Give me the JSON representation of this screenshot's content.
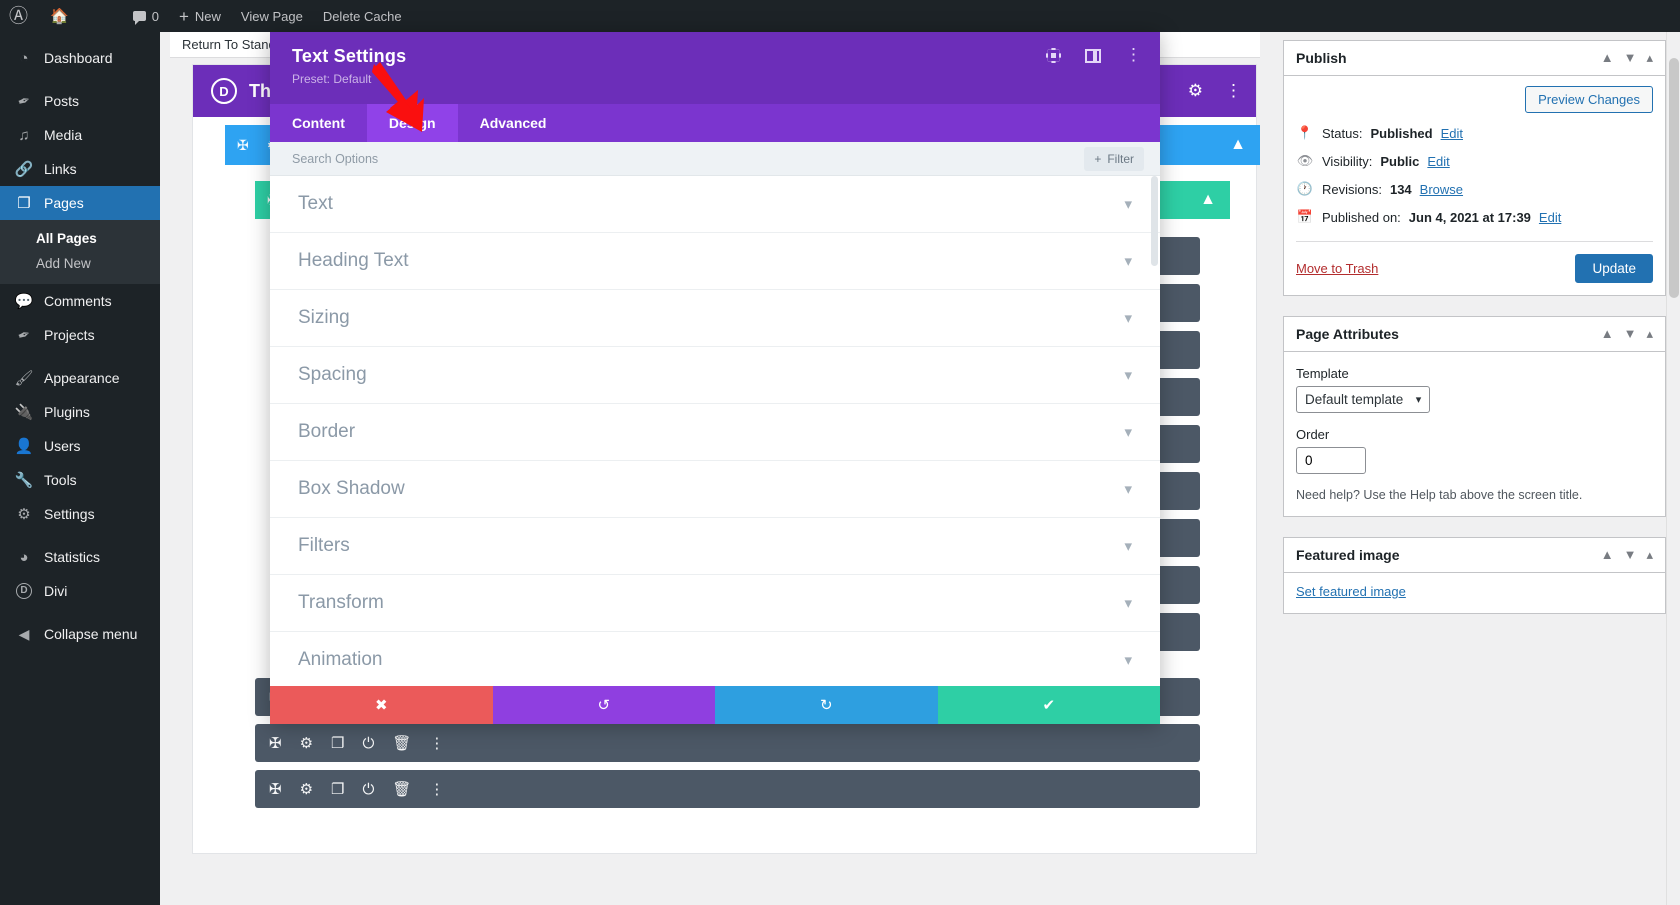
{
  "adminbar": {
    "logo_icon": "wordpress-logo-icon",
    "home_icon": "home-icon",
    "comments_count": "0",
    "new_label": "New",
    "view_page_label": "View Page",
    "delete_cache_label": "Delete Cache"
  },
  "sidebar": {
    "items": [
      {
        "label": "Dashboard",
        "icon": "dashboard-icon",
        "current": false
      },
      {
        "label": "Posts",
        "icon": "posts-pin-icon",
        "current": false
      },
      {
        "label": "Media",
        "icon": "media-icon",
        "current": false
      },
      {
        "label": "Links",
        "icon": "links-chain-icon",
        "current": false
      },
      {
        "label": "Pages",
        "icon": "pages-icon",
        "current": true
      },
      {
        "label": "Comments",
        "icon": "comments-icon",
        "current": false
      },
      {
        "label": "Projects",
        "icon": "projects-pin-icon",
        "current": false
      },
      {
        "label": "Appearance",
        "icon": "appearance-brush-icon",
        "current": false
      },
      {
        "label": "Plugins",
        "icon": "plugins-plug-icon",
        "current": false
      },
      {
        "label": "Users",
        "icon": "users-icon",
        "current": false
      },
      {
        "label": "Tools",
        "icon": "tools-wrench-icon",
        "current": false
      },
      {
        "label": "Settings",
        "icon": "settings-sliders-icon",
        "current": false
      },
      {
        "label": "Statistics",
        "icon": "statistics-pie-icon",
        "current": false
      },
      {
        "label": "Divi",
        "icon": "divi-logo-icon",
        "current": false
      }
    ],
    "submenu": [
      {
        "label": "All Pages",
        "active": true
      },
      {
        "label": "Add New",
        "active": false
      }
    ],
    "collapse_label": "Collapse menu",
    "active_color": "#2271b1"
  },
  "canvas": {
    "return_label": "Return To Standard Editor",
    "divi_title": "The Divi Builder",
    "divi_logo_letter": "D",
    "divi_bar_color": "#6c2eb9",
    "section_color": "#2ea3f2",
    "row_color": "#2ecfa5",
    "module_color": "#4c5866",
    "module_icons": [
      "move-icon",
      "gear-icon",
      "duplicate-icon",
      "power-icon",
      "trash-icon",
      "kebab-icon"
    ]
  },
  "modal": {
    "title": "Text Settings",
    "preset": "Preset: Default",
    "header_icons": [
      "expand-icon",
      "panel-layout-icon",
      "kebab-icon"
    ],
    "header_color": "#6c2eb9",
    "tabs": [
      {
        "label": "Content",
        "active": false
      },
      {
        "label": "Design",
        "active": true
      },
      {
        "label": "Advanced",
        "active": false
      }
    ],
    "search_placeholder": "Search Options",
    "filter_label": "Filter",
    "filter_icon": "plus-icon",
    "sections": [
      {
        "label": "Text"
      },
      {
        "label": "Heading Text"
      },
      {
        "label": "Sizing"
      },
      {
        "label": "Spacing"
      },
      {
        "label": "Border"
      },
      {
        "label": "Box Shadow"
      },
      {
        "label": "Filters"
      },
      {
        "label": "Transform"
      },
      {
        "label": "Animation"
      }
    ],
    "footer": [
      {
        "name": "cancel",
        "icon": "close-x-icon",
        "glyph": "✖",
        "color": "#eb5a5a"
      },
      {
        "name": "undo",
        "icon": "undo-icon",
        "glyph": "↺",
        "color": "#8f3fe0"
      },
      {
        "name": "redo",
        "icon": "redo-icon",
        "glyph": "↻",
        "color": "#2e9fe0"
      },
      {
        "name": "save",
        "icon": "check-icon",
        "glyph": "✔",
        "color": "#2ecfa5"
      }
    ]
  },
  "publish": {
    "title": "Publish",
    "preview_label": "Preview Changes",
    "rows": [
      {
        "icon": "pin-icon",
        "label": "Status:",
        "value": "Published",
        "link": "Edit"
      },
      {
        "icon": "eye-icon",
        "label": "Visibility:",
        "value": "Public",
        "link": "Edit"
      },
      {
        "icon": "clock-icon",
        "label": "Revisions:",
        "value": "134",
        "link": "Browse"
      },
      {
        "icon": "calendar-icon",
        "label": "Published on:",
        "value": "Jun 4, 2021 at 17:39",
        "link": "Edit"
      }
    ],
    "trash_label": "Move to Trash",
    "update_label": "Update"
  },
  "page_attributes": {
    "title": "Page Attributes",
    "template_label": "Template",
    "template_value": "Default template",
    "order_label": "Order",
    "order_value": "0",
    "help_text": "Need help? Use the Help tab above the screen title."
  },
  "featured_image": {
    "title": "Featured image",
    "set_label": "Set featured image"
  },
  "annotation": {
    "arrow_color": "#fa0f0f",
    "points_to": "Design"
  }
}
